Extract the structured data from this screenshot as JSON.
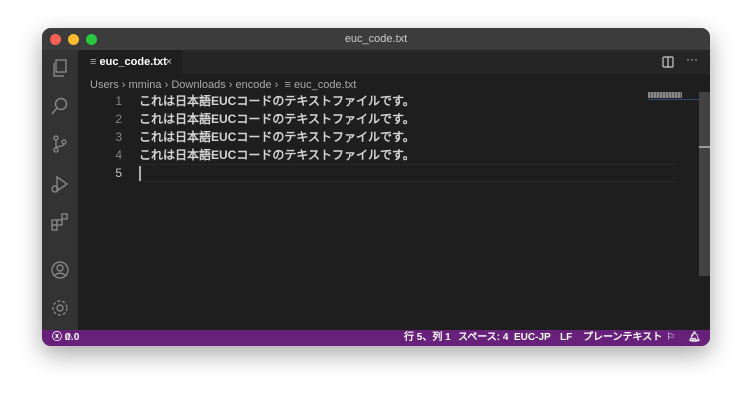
{
  "window": {
    "title": "euc_code.txt"
  },
  "tab": {
    "label": "euc_code.txt",
    "close": "×"
  },
  "breadcrumb": [
    "Users",
    "mmina",
    "Downloads",
    "encode",
    "euc_code.txt"
  ],
  "editor": {
    "lines": [
      {
        "n": "1",
        "text": "これは日本語EUCコードのテキストファイルです。"
      },
      {
        "n": "2",
        "text": "これは日本語EUCコードのテキストファイルです。"
      },
      {
        "n": "3",
        "text": "これは日本語EUCコードのテキストファイルです。"
      },
      {
        "n": "4",
        "text": "これは日本語EUCコードのテキストファイルです。"
      },
      {
        "n": "5",
        "text": ""
      }
    ]
  },
  "status": {
    "errors": "0",
    "warnings": "0",
    "position": "行 5、列 1",
    "spaces": "スペース: 4",
    "encoding": "EUC-JP",
    "eol": "LF",
    "language": "プレーンテキスト"
  },
  "colors": {
    "statusbar": "#68217a"
  }
}
